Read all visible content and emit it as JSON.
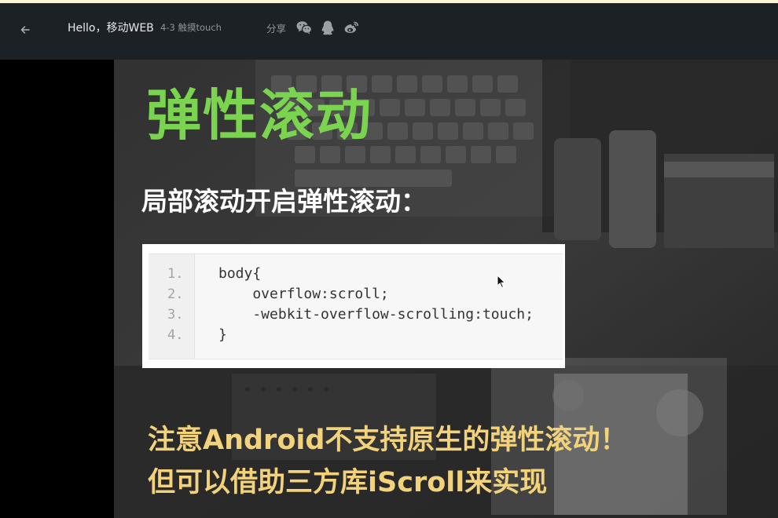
{
  "header": {
    "title": "Hello，移动WEB",
    "subtitle": "4-3 触摸touch",
    "share_label": "分享",
    "share_icons": [
      "wechat-icon",
      "qq-icon",
      "weibo-icon"
    ],
    "colors": {
      "bar": "#1c2126",
      "top_strip": "#fbf4d2"
    }
  },
  "slide": {
    "title": "弹性滚动",
    "subtitle": "局部滚动开启弹性滚动：",
    "code": {
      "line_numbers": [
        "1.",
        "2.",
        "3.",
        "4."
      ],
      "lines": [
        "body{",
        "    overflow:scroll;",
        "    -webkit-overflow-scrolling:touch;",
        "}"
      ]
    },
    "note_line1": "注意Android不支持原生的弹性滚动！",
    "note_line2": "但可以借助三方库iScroll来实现",
    "colors": {
      "title": "#7bd44f",
      "note": "#f2d27a"
    }
  }
}
